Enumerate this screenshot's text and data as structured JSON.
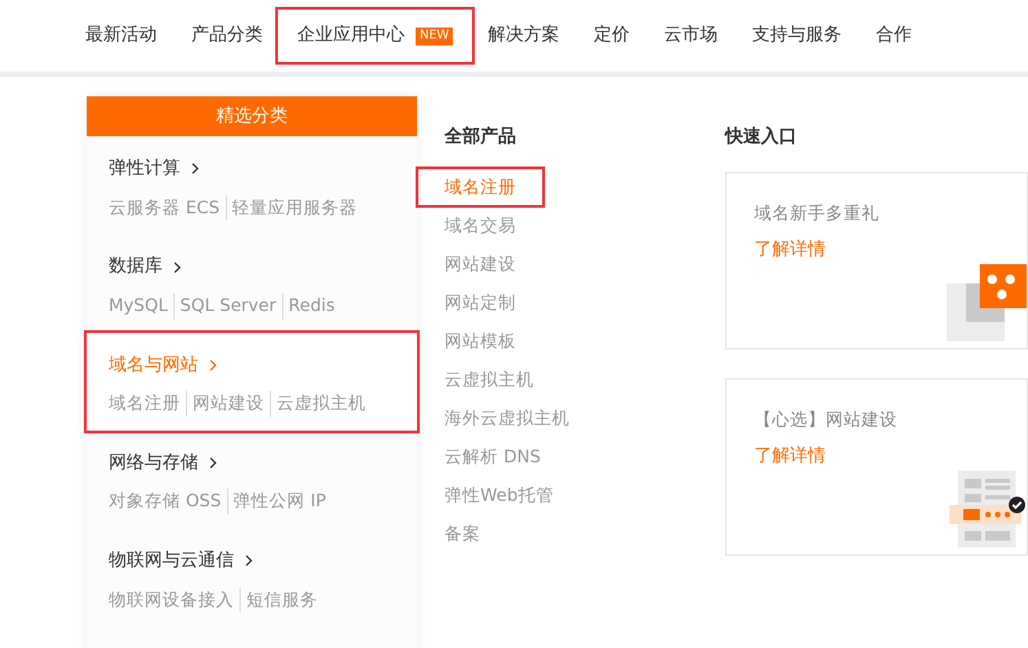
{
  "nav": [
    {
      "label": "最新活动",
      "highlighted": false
    },
    {
      "label": "产品分类",
      "highlighted": false
    },
    {
      "label": "企业应用中心",
      "highlighted": true,
      "badge": "NEW"
    },
    {
      "label": "解决方案",
      "highlighted": false
    },
    {
      "label": "定价",
      "highlighted": false
    },
    {
      "label": "云市场",
      "highlighted": false
    },
    {
      "label": "支持与服务",
      "highlighted": false
    },
    {
      "label": "合作",
      "highlighted": false
    }
  ],
  "categories": {
    "header": "精选分类",
    "items": [
      {
        "title": "弹性计算",
        "selected": false,
        "highlighted": false,
        "links": [
          "云服务器 ECS",
          "轻量应用服务器"
        ]
      },
      {
        "title": "数据库",
        "selected": false,
        "highlighted": false,
        "links": [
          "MySQL",
          "SQL Server",
          "Redis"
        ]
      },
      {
        "title": "域名与网站",
        "selected": true,
        "highlighted": true,
        "links": [
          "域名注册",
          "网站建设",
          "云虚拟主机"
        ]
      },
      {
        "title": "网络与存储",
        "selected": false,
        "highlighted": false,
        "links": [
          "对象存储 OSS",
          "弹性公网 IP"
        ]
      },
      {
        "title": "物联网与云通信",
        "selected": false,
        "highlighted": false,
        "links": [
          "物联网设备接入",
          "短信服务"
        ]
      }
    ]
  },
  "products": {
    "title": "全部产品",
    "items": [
      {
        "label": "域名注册",
        "selected": true,
        "highlighted": true
      },
      {
        "label": "域名交易",
        "selected": false,
        "highlighted": false
      },
      {
        "label": "网站建设",
        "selected": false,
        "highlighted": false
      },
      {
        "label": "网站定制",
        "selected": false,
        "highlighted": false
      },
      {
        "label": "网站模板",
        "selected": false,
        "highlighted": false
      },
      {
        "label": "云虚拟主机",
        "selected": false,
        "highlighted": false
      },
      {
        "label": "海外云虚拟主机",
        "selected": false,
        "highlighted": false
      },
      {
        "label": "云解析 DNS",
        "selected": false,
        "highlighted": false
      },
      {
        "label": "弹性Web托管",
        "selected": false,
        "highlighted": false
      },
      {
        "label": "备案",
        "selected": false,
        "highlighted": false
      }
    ]
  },
  "quick_entry": {
    "title": "快速入口",
    "cards": [
      {
        "kind": "gift",
        "title": "域名新手多重礼",
        "link": "了解详情"
      },
      {
        "kind": "website",
        "title": "【心选】网站建设",
        "link": "了解详情"
      }
    ]
  }
}
